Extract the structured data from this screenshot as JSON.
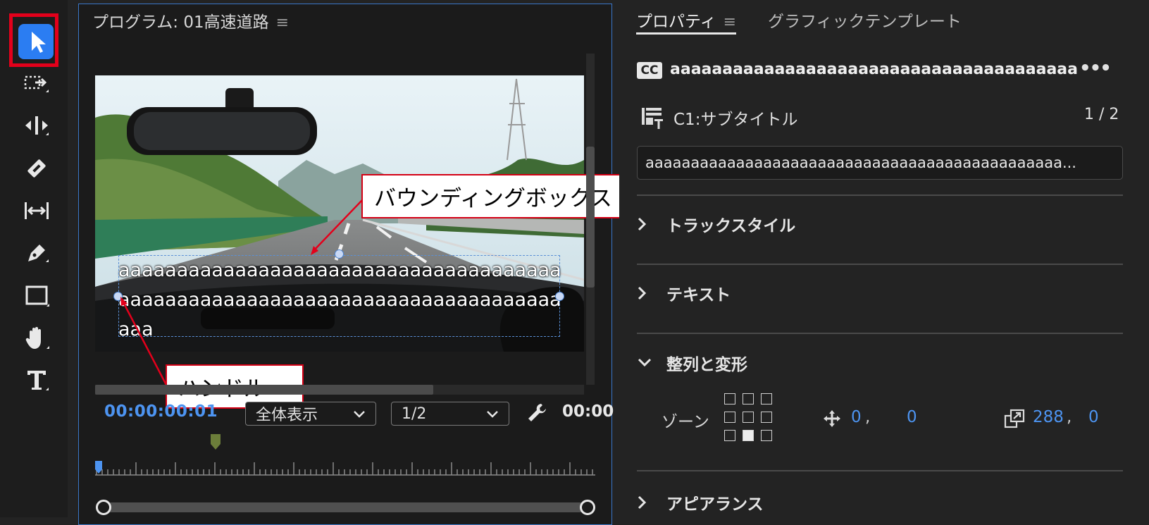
{
  "program_monitor": {
    "title": "プログラム: 01高速道路",
    "menu_glyph": "≡",
    "caption_text": "aaaaaaaaaaaaaaaaaaaaaaaaaaaaaaaaaaaaaaaaaaaaaaaaaaaaaaaaaaaaaaaaaaaaaaaaaaaaaaa",
    "timecode": "00:00:00:01",
    "zoom_select": "全体表示",
    "resolution_select": "1/2",
    "timecode_right": "00:00"
  },
  "callouts": {
    "bounding_box": "バウンディングボックス",
    "handle": "ハンドル"
  },
  "properties": {
    "tab_properties": "プロパティ",
    "tab_menu_glyph": "≡",
    "tab_graphic_template": "グラフィックテンプレート",
    "cc_badge": "CC",
    "caption_name": "aaaaaaaaaaaaaaaaaaaaaaaaaaaaaaaaaaaaaaa...",
    "more": "•••",
    "track_name": "C1:サブタイトル",
    "track_count": "1 / 2",
    "text_field_value": "aaaaaaaaaaaaaaaaaaaaaaaaaaaaaaaaaaaaaaaaaaaaaa...",
    "sections": {
      "track_style": "トラックスタイル",
      "text": "テキスト",
      "align_transform": "整列と変形",
      "appearance": "アピアランス"
    },
    "zone_label": "ゾーン",
    "position_x": "0",
    "position_y": "0",
    "scale_x": "288",
    "scale_y": "0",
    "comma": ","
  },
  "colors": {
    "accent_blue": "#2b7df2",
    "timecode_blue": "#4d94f1",
    "callout_red": "#d40015"
  }
}
